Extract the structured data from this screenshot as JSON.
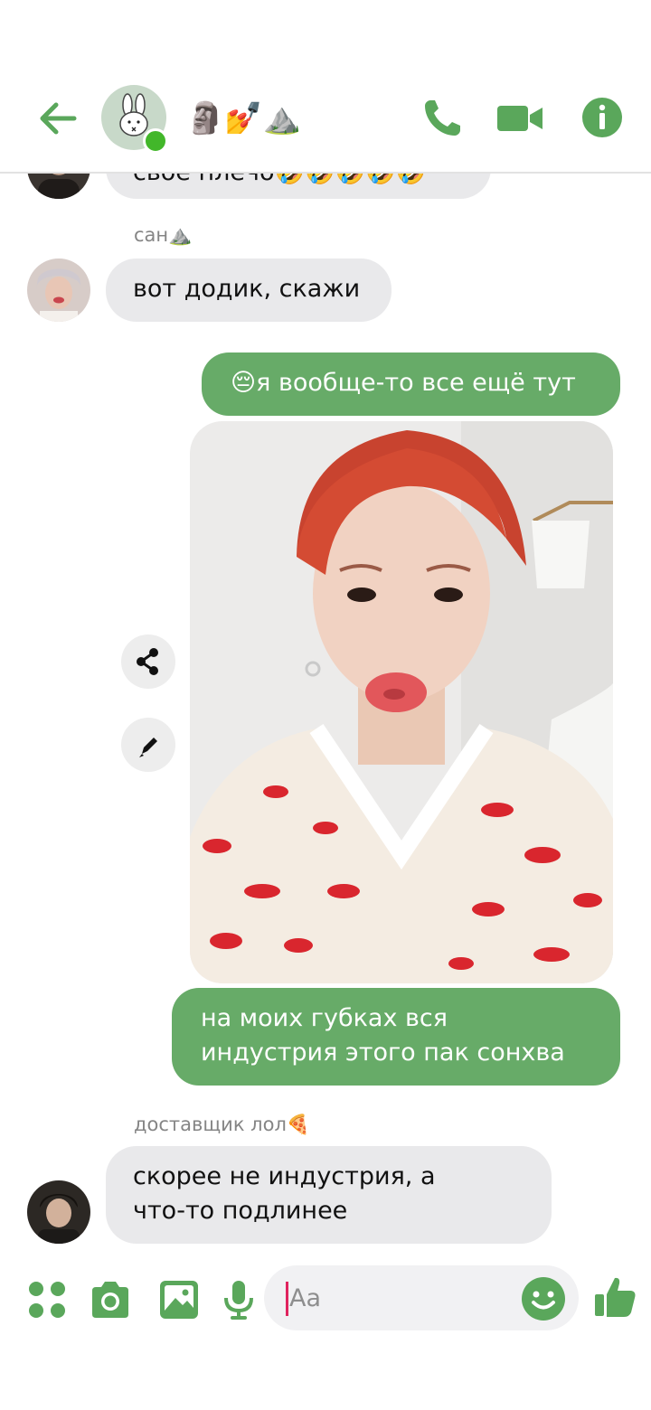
{
  "header": {
    "title": "🗿💅⛰️",
    "colors": {
      "accent": "#5aa75b",
      "online": "#42b72a"
    }
  },
  "messages": {
    "top_cut_text": "свое плечо🤣🤣🤣🤣🤣",
    "msg1_sender": "сан⛰️",
    "msg1_text": "вот додик, скажи",
    "msg2_text": "😔я вообще-то все ещё тут",
    "msg3_text_line1": "на моих губках вся",
    "msg3_text_line2": "индустрия этого пак сонхва",
    "msg4_sender": "доставщик лол🍕",
    "msg4_text_line1": "скорее не индустрия, а",
    "msg4_text_line2": "что-то подлинее"
  },
  "composer": {
    "placeholder": "Aa"
  },
  "icons": {
    "header": [
      "back-arrow-icon",
      "phone-icon",
      "video-call-icon",
      "info-icon"
    ],
    "photo_actions": [
      "share-icon",
      "edit-pencil-icon"
    ],
    "composer": [
      "apps-grid-icon",
      "camera-icon",
      "gallery-icon",
      "microphone-icon",
      "emoji-icon",
      "thumbs-up-icon"
    ]
  },
  "colors": {
    "outgoing_bubble": "#67ab68",
    "incoming_bubble": "#e9e9eb",
    "icon_green": "#5aa75b"
  }
}
